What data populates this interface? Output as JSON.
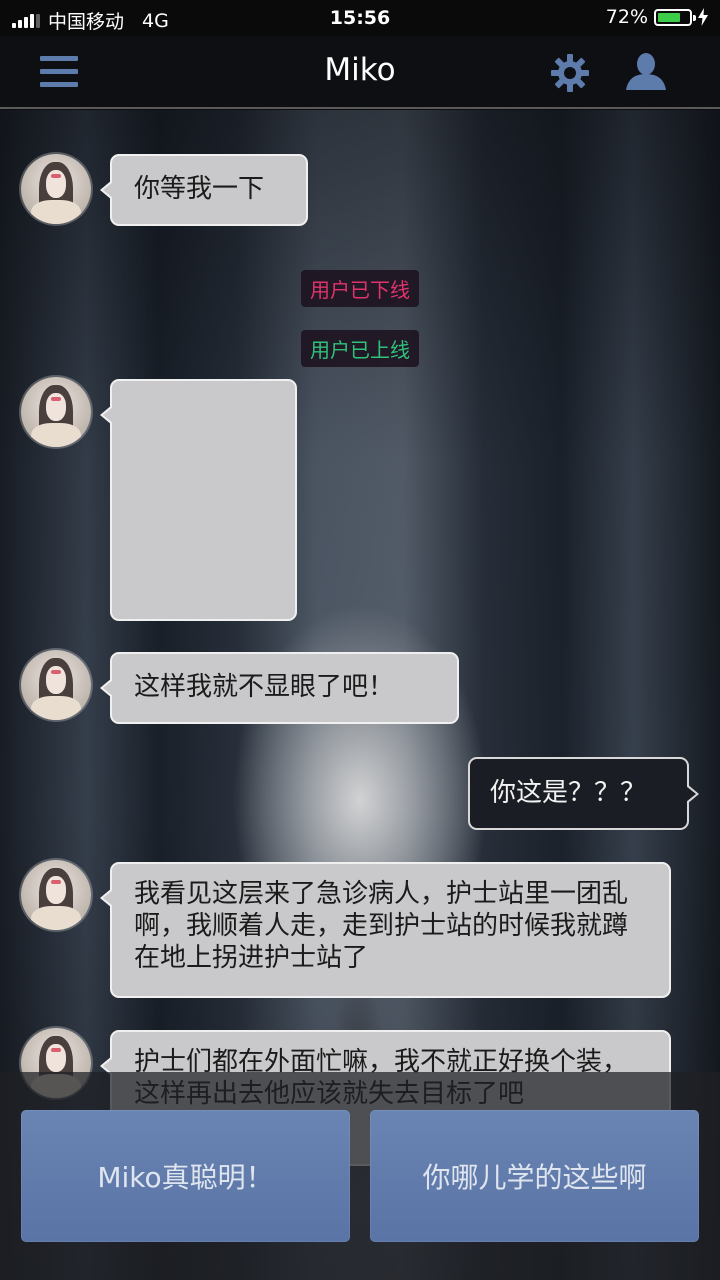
{
  "status_bar": {
    "carrier": "中国移动",
    "network": "4G",
    "time": "15:56",
    "battery_percent_label": "72%",
    "battery_level": 0.72
  },
  "header": {
    "title": "Miko",
    "menu_icon": "hamburger-menu-icon",
    "settings_icon": "gear-icon",
    "profile_icon": "user-icon",
    "accent_color": "#5d7bab"
  },
  "system_notices": {
    "offline": "用户已下线",
    "online": "用户已上线",
    "offline_color": "#e0336b",
    "online_color": "#2ec27a"
  },
  "messages": [
    {
      "sender": "Miko",
      "text": "你等我一下"
    },
    {
      "sender": "Miko",
      "text": ""
    },
    {
      "sender": "Miko",
      "text": "这样我就不显眼了吧！"
    },
    {
      "sender": "me",
      "text": "你这是？？？"
    },
    {
      "sender": "Miko",
      "text": "我看见这层来了急诊病人，护士站里一团乱啊，我顺着人走，走到护士站的时候我就蹲在地上拐进护士站了"
    },
    {
      "sender": "Miko",
      "text": "护士们都在外面忙嘛，我不就正好换个装，这样再出去他应该就失去目标了吧"
    }
  ],
  "replies": [
    {
      "label": "Miko真聪明！"
    },
    {
      "label": "你哪儿学的这些啊"
    }
  ]
}
